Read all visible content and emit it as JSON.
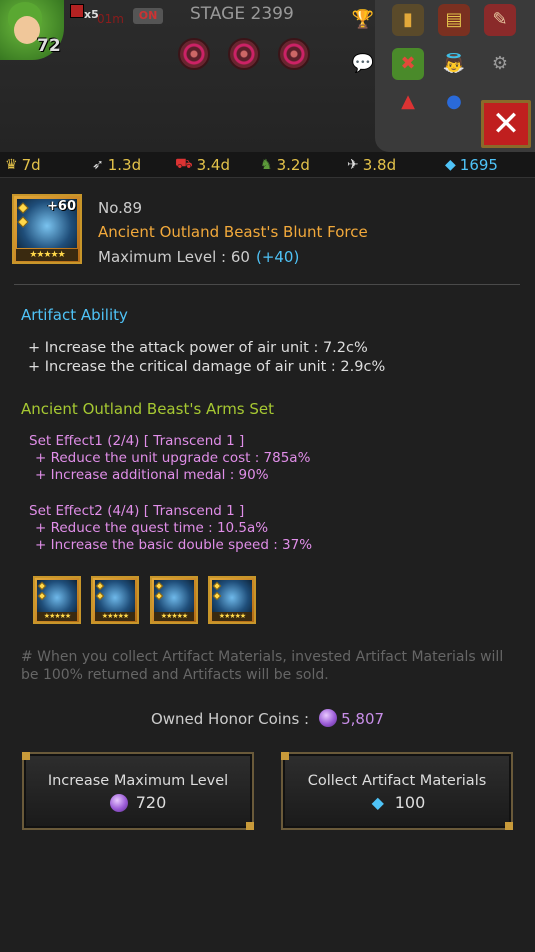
{
  "hud": {
    "player_level": "72",
    "multiplier": "x5",
    "timer": "01m",
    "toggle": "ON",
    "stage": "STAGE 2399"
  },
  "resources": [
    {
      "icon": "crown-icon",
      "value": "7d"
    },
    {
      "icon": "feather-icon",
      "value": "1.3d"
    },
    {
      "icon": "cart-icon",
      "value": "3.4d"
    },
    {
      "icon": "dragon-icon",
      "value": "3.2d"
    },
    {
      "icon": "wing-icon",
      "value": "3.8d"
    },
    {
      "icon": "gem-icon",
      "value": "1695"
    }
  ],
  "artifact": {
    "plus": "+60",
    "number": "No.89",
    "name": "Ancient Outland Beast's Blunt Force",
    "max_level_label": "Maximum Level : ",
    "max_level_value": "60",
    "max_level_bonus": "(+40)",
    "stars": "★★★★★"
  },
  "ability": {
    "title": "Artifact Ability",
    "lines": [
      "+ Increase the attack power of air unit : 7.2c%",
      "+ Increase the critical damage of air unit : 2.9c%"
    ]
  },
  "set": {
    "title": "Ancient Outland Beast's Arms Set",
    "effect1_title": "Set Effect1 (2/4)  [ Transcend 1 ]",
    "effect1_lines": [
      "+ Reduce the unit upgrade cost : 785a%",
      "+ Increase additional medal : 90%"
    ],
    "effect2_title": "Set Effect2 (4/4)  [ Transcend 1 ]",
    "effect2_lines": [
      "+ Reduce the quest time : 10.5a%",
      "+ Increase the basic double speed : 37%"
    ],
    "item_stars": "★★★★★"
  },
  "note": "# When you collect Artifact Materials, invested Artifact Materials will be 100% returned and Artifacts will be sold.",
  "honor": {
    "label": "Owned Honor Coins :",
    "value": "5,807"
  },
  "buttons": {
    "increase": {
      "label": "Increase Maximum Level",
      "cost": "720"
    },
    "collect": {
      "label": "Collect Artifact Materials",
      "cost": "100"
    }
  }
}
